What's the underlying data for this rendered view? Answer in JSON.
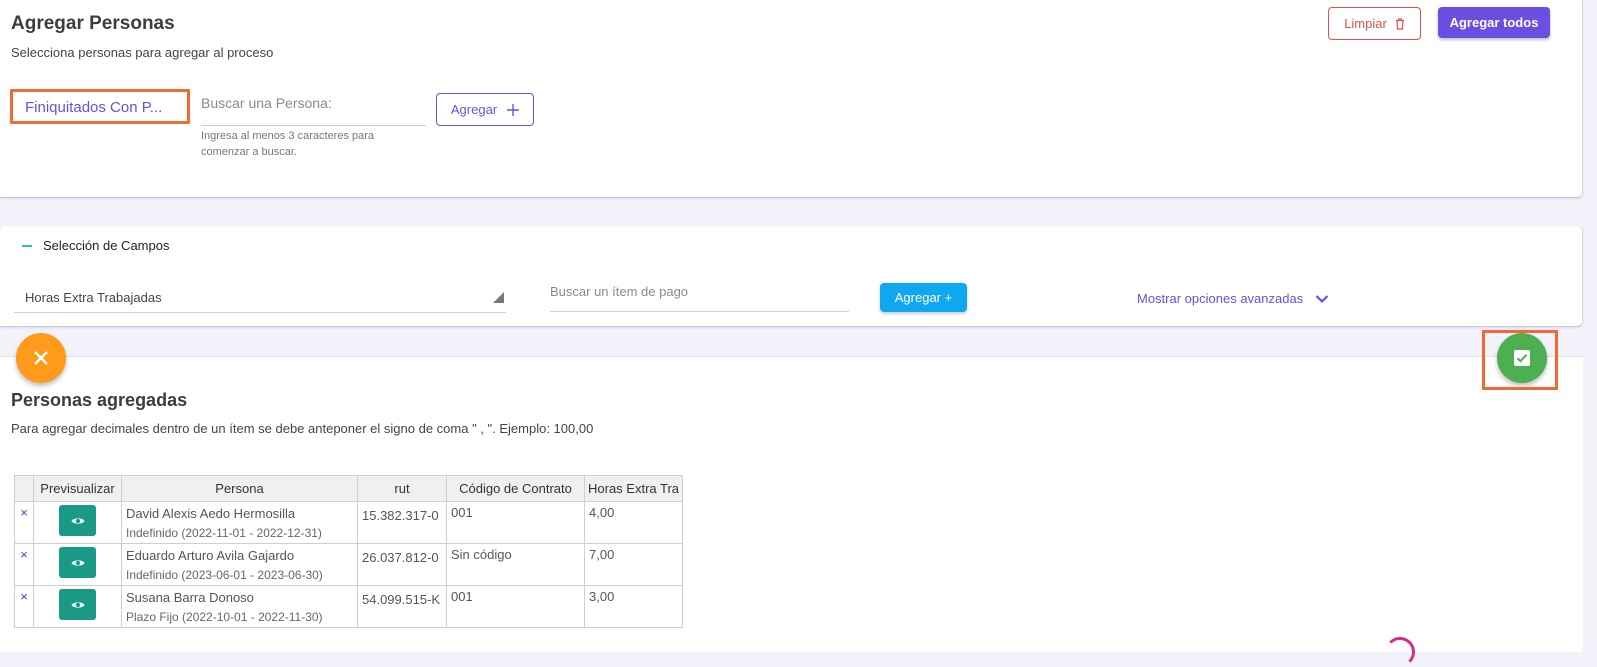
{
  "header": {
    "title": "Agregar Personas",
    "subtitle": "Selecciona personas para agregar al proceso",
    "clear_label": "Limpiar",
    "add_all_label": "Agregar todos"
  },
  "add_person": {
    "group_select_value": "Finiquitados Con P...",
    "search_placeholder": "Buscar una Persona:",
    "hint": "Ingresa al menos 3 caracteres para comenzar a buscar.",
    "add_label": "Agregar"
  },
  "fields_section": {
    "title": "Selección de Campos",
    "field_select_value": "Horas Extra Trabajadas",
    "item_search_placeholder": "Buscar un ítem de pago",
    "add_label": "Agregar +",
    "advanced_label": "Mostrar opciones avanzadas"
  },
  "added": {
    "title": "Personas agregadas",
    "note": "Para agregar decimales dentro de un ítem se debe anteponer el signo de coma \" , \". Ejemplo: 100,00",
    "columns": [
      "",
      "Previsualizar",
      "Persona",
      "rut",
      "Código de Contrato",
      "Horas Extra Tra"
    ],
    "rows": [
      {
        "name": "David Alexis Aedo Hermosilla",
        "contract": "Indefinido (2022-11-01 - 2022-12-31)",
        "rut": "15.382.317-0",
        "code": "001",
        "hours": "4,00"
      },
      {
        "name": "Eduardo Arturo Avila Gajardo",
        "contract": "Indefinido (2023-06-01 - 2023-06-30)",
        "rut": "26.037.812-0",
        "code": "Sin código",
        "hours": "7,00"
      },
      {
        "name": "Susana Barra Donoso",
        "contract": "Plazo Fijo (2022-10-01 - 2022-11-30)",
        "rut": "54.099.515-K",
        "code": "001",
        "hours": "3,00"
      }
    ],
    "remove_glyph": "×"
  },
  "colors": {
    "primary": "#6a4fe0",
    "danger": "#e0524a",
    "info": "#0ea7f0",
    "success": "#4caf50",
    "warning": "#ff9a1a",
    "preview": "#1a9a86",
    "highlight": "#f06a36"
  },
  "icons": {
    "clear": "trash-icon",
    "add": "plus-icon",
    "advanced": "chevron-down-icon",
    "close": "close-icon",
    "confirm": "check-box-icon",
    "preview": "eye-icon"
  }
}
